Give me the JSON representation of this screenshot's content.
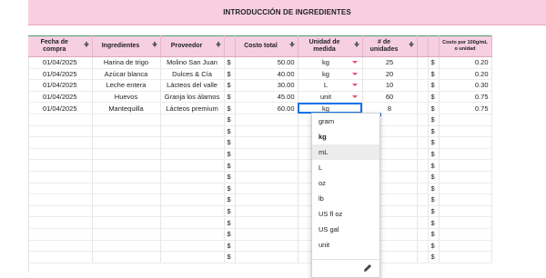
{
  "banner_title": "INTRODUCCIÓN DE INGREDIENTES",
  "headers": {
    "fecha": "Fecha de compra",
    "ingredientes": "Ingredientes",
    "proveedor": "Proveedor",
    "costo_total": "Costo total",
    "unidad": "Unidad de medida",
    "num_unidades": "# de unidades",
    "costo_por": "Costo por 100g/mL o unidad"
  },
  "currency_symbol": "$",
  "rows": [
    {
      "fecha": "01/04/2025",
      "ingrediente": "Harina de trigo",
      "proveedor": "Molino San Juan",
      "costo": "50.00",
      "unidad": "kg",
      "num": "25",
      "costo_por": "0.20"
    },
    {
      "fecha": "01/04/2025",
      "ingrediente": "Azúcar blanca",
      "proveedor": "Dulces & Cía",
      "costo": "40.00",
      "unidad": "kg",
      "num": "20",
      "costo_por": "0.20"
    },
    {
      "fecha": "01/04/2025",
      "ingrediente": "Leche entera",
      "proveedor": "Lácteos del valle",
      "costo": "30.00",
      "unidad": "L",
      "num": "10",
      "costo_por": "0.30"
    },
    {
      "fecha": "01/04/2025",
      "ingrediente": "Huevos",
      "proveedor": "Granja los álamos",
      "costo": "45.00",
      "unidad": "unit",
      "num": "60",
      "costo_por": "0.75"
    },
    {
      "fecha": "01/04/2025",
      "ingrediente": "Mantequilla",
      "proveedor": "Lácteos premium",
      "costo": "60.00",
      "unidad": "kg",
      "num": "8",
      "costo_por": "0.75"
    }
  ],
  "unit_menu": {
    "options": [
      "gram",
      "kg",
      "mL",
      "L",
      "oz",
      "lb",
      "US fl oz",
      "US gal",
      "unit"
    ],
    "selected": "kg",
    "highlighted": "mL"
  },
  "colors": {
    "banner": "#f8cfe0",
    "header_bg": "#f6cfe0",
    "dropdown_arrow": "#e44d6b",
    "selection": "#1a73e8"
  }
}
